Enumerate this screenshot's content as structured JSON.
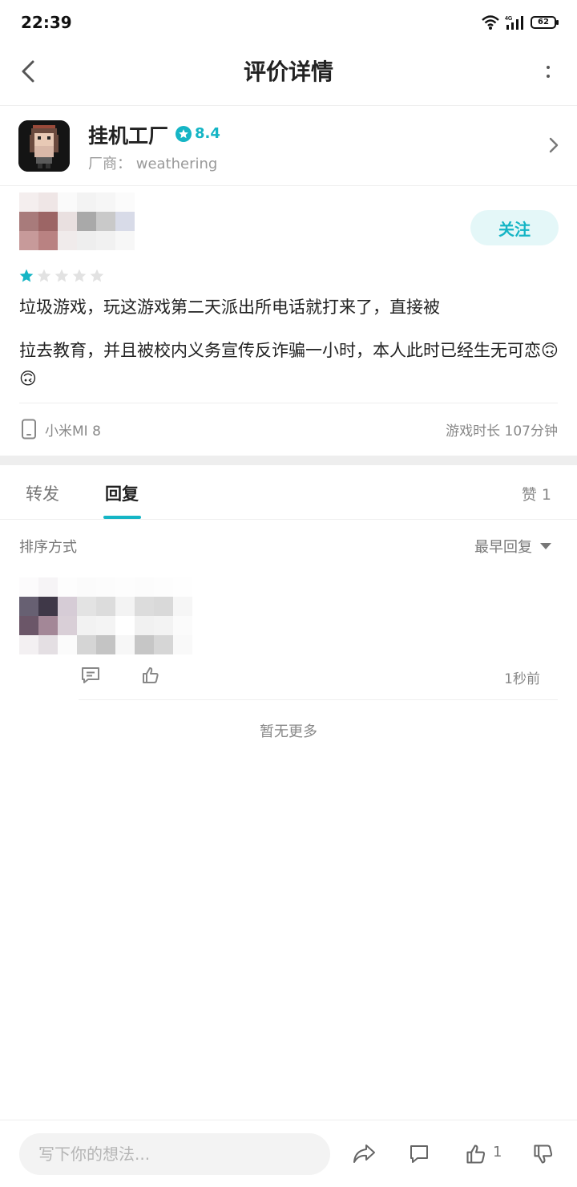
{
  "status_bar": {
    "time": "22:39",
    "battery": "62",
    "network": "4G"
  },
  "header": {
    "title": "评价详情"
  },
  "game": {
    "name": "挂机工厂",
    "rating": "8.4",
    "developer_line": "厂商： weathering"
  },
  "review": {
    "follow_label": "关注",
    "stars_filled": 1,
    "stars_total": 5,
    "text_line1": "垃圾游戏，玩这游戏第二天派出所电话就打来了，直接被",
    "text_line2": "拉去教育，并且被校内义务宣传反诈骗一小时，本人此时已经生无可恋🙃🙃",
    "device": "小米MI 8",
    "playtime": "游戏时长 107分钟"
  },
  "tabs": {
    "forward": "转发",
    "reply": "回复",
    "likes": "赞 1"
  },
  "sort": {
    "label": "排序方式",
    "value": "最早回复"
  },
  "reply_item": {
    "time": "1秒前"
  },
  "list_end": "暂无更多",
  "bottom_bar": {
    "placeholder": "写下你的想法...",
    "like_count": "1"
  },
  "colors": {
    "accent": "#15b5c5",
    "follow_bg": "#e4f7f8",
    "divider": "#eeeeee"
  }
}
